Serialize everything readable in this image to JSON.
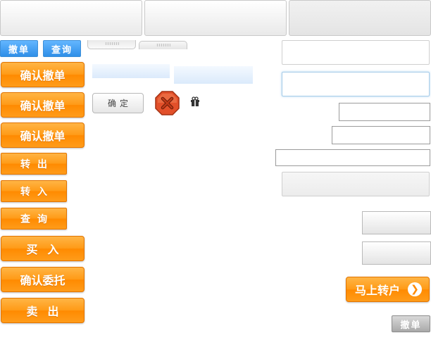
{
  "toolbar": {
    "cancel_small": "撤单",
    "query_small": "查询"
  },
  "buttons": {
    "confirm_cancel_1": "确认撤单",
    "confirm_cancel_2": "确认撤单",
    "confirm_cancel_3": "确认撤单",
    "transfer_out": "转出",
    "transfer_in": "转入",
    "query": "查询",
    "buy": "买入",
    "confirm_order": "确认委托",
    "sell": "卖出",
    "ok": "确定",
    "go_transfer": "马上转户",
    "cancel_gray": "撤单"
  },
  "icons": {
    "close": "close-icon",
    "gift": "gift-icon",
    "arrow": "arrow-right-circle-icon"
  },
  "colors": {
    "orange": "#ff9a16",
    "blue": "#2f8fe8",
    "close_red": "#e2502a"
  }
}
